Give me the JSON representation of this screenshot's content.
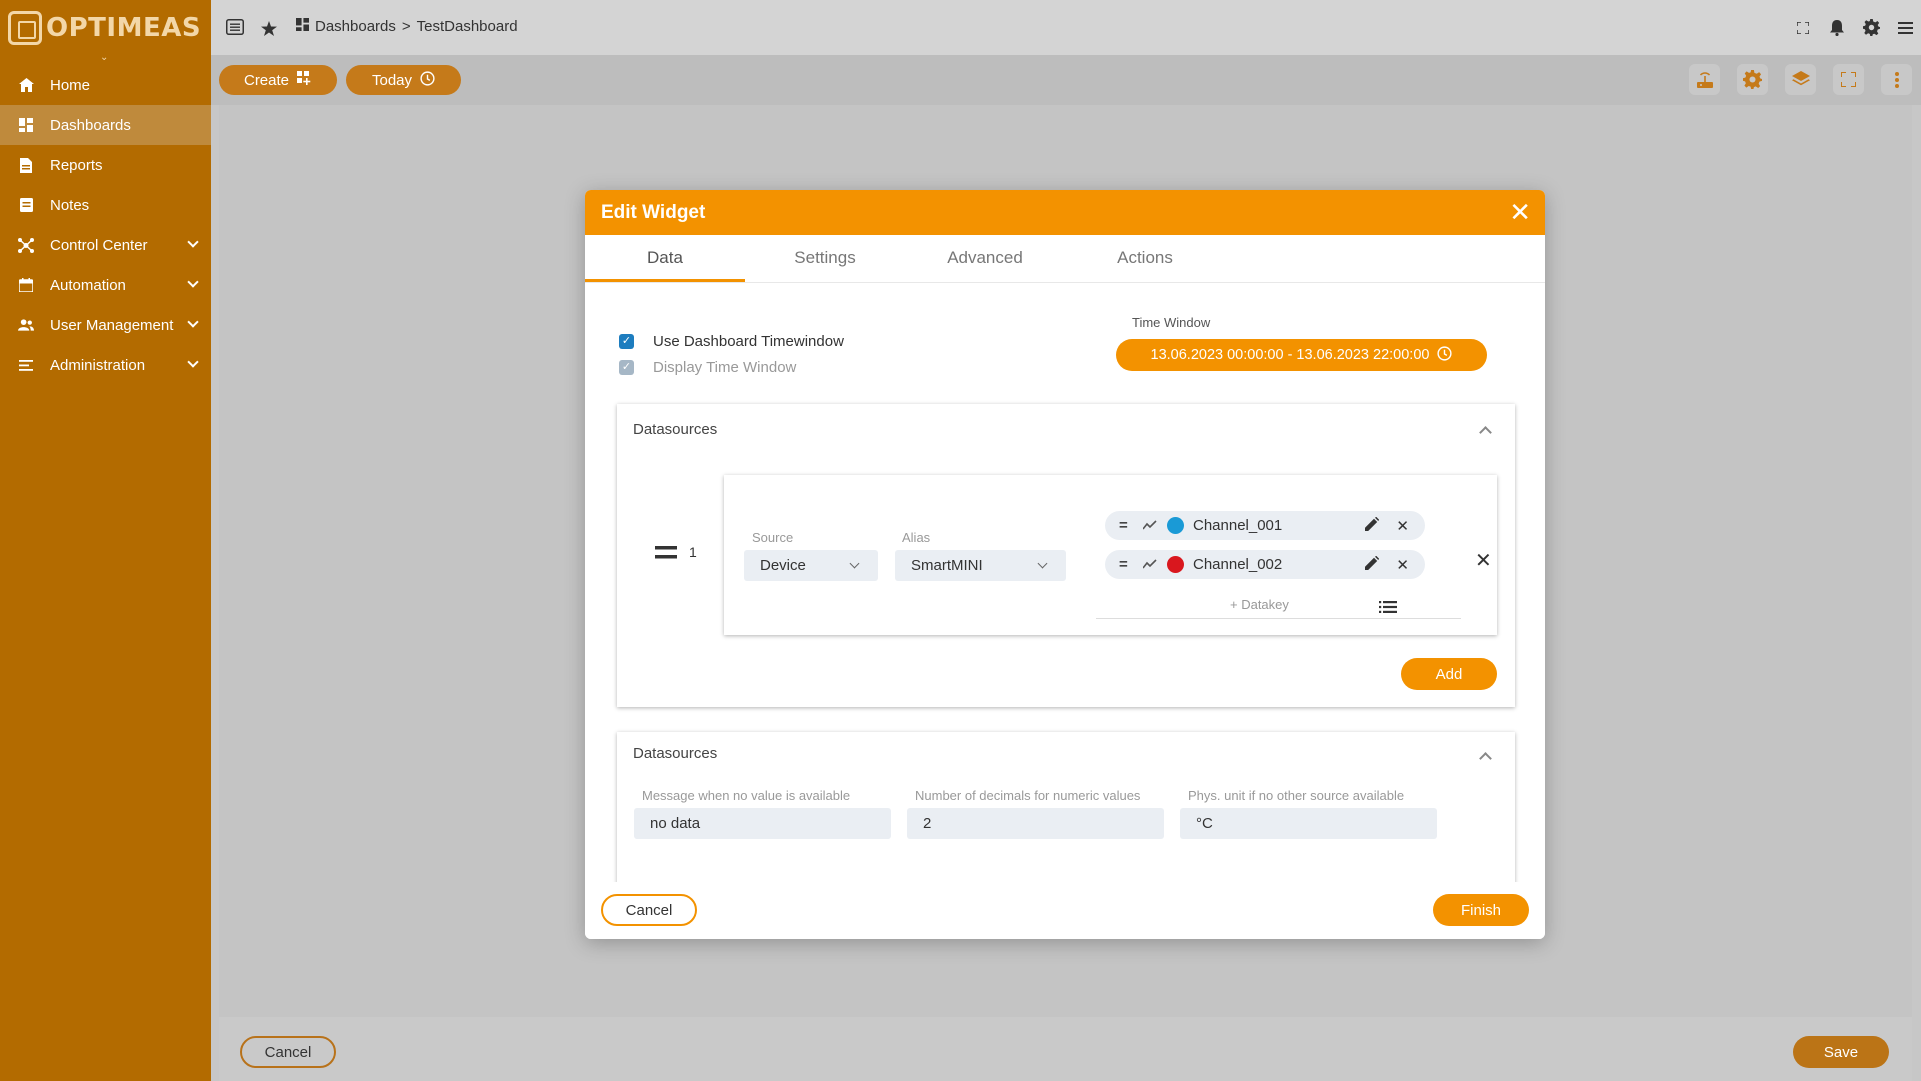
{
  "brand": {
    "logo_text": "OPTIMEAS"
  },
  "sidebar": {
    "items": [
      {
        "label": "Home",
        "icon": "home-icon"
      },
      {
        "label": "Dashboards",
        "icon": "dashboards-icon",
        "active": true
      },
      {
        "label": "Reports",
        "icon": "report-icon"
      },
      {
        "label": "Notes",
        "icon": "notes-icon"
      },
      {
        "label": "Control Center",
        "icon": "control-center-icon",
        "expandable": true
      },
      {
        "label": "Automation",
        "icon": "calendar-icon",
        "expandable": true
      },
      {
        "label": "User Management",
        "icon": "users-icon",
        "expandable": true
      },
      {
        "label": "Administration",
        "icon": "admin-list-icon",
        "expandable": true
      }
    ]
  },
  "topbar": {
    "breadcrumb_root": "Dashboards",
    "breadcrumb_sep": ">",
    "breadcrumb_current": "TestDashboard"
  },
  "toolbar": {
    "create_label": "Create",
    "today_label": "Today"
  },
  "modal": {
    "title": "Edit Widget",
    "tabs": [
      "Data",
      "Settings",
      "Advanced",
      "Actions"
    ],
    "active_tab": "Data",
    "use_dashboard_timewindow": "Use Dashboard Timewindow",
    "display_time_window": "Display Time Window",
    "time_window_label": "Time Window",
    "time_window_value": "13.06.2023 00:00:00 - 13.06.2023 22:00:00",
    "datasources_title": "Datasources",
    "datasource": {
      "index": "1",
      "source_label": "Source",
      "source_value": "Device",
      "alias_label": "Alias",
      "alias_value": "SmartMINI",
      "datakeys": [
        {
          "name": "Channel_001",
          "color": "#1a9ad6"
        },
        {
          "name": "Channel_002",
          "color": "#d9171e"
        }
      ],
      "add_datakey": "+ Datakey"
    },
    "add_label": "Add",
    "datasources2_title": "Datasources",
    "no_value_label": "Message when no value is available",
    "no_value_value": "no data",
    "decimals_label": "Number of decimals for numeric values",
    "decimals_value": "2",
    "unit_label": "Phys. unit if no other source available",
    "unit_value": "°C",
    "cancel_label": "Cancel",
    "finish_label": "Finish"
  },
  "bottom": {
    "cancel_label": "Cancel",
    "save_label": "Save"
  },
  "colors": {
    "accent": "#f39200",
    "sidebar": "#b36b00",
    "checkbox": "#1d7dbf"
  }
}
